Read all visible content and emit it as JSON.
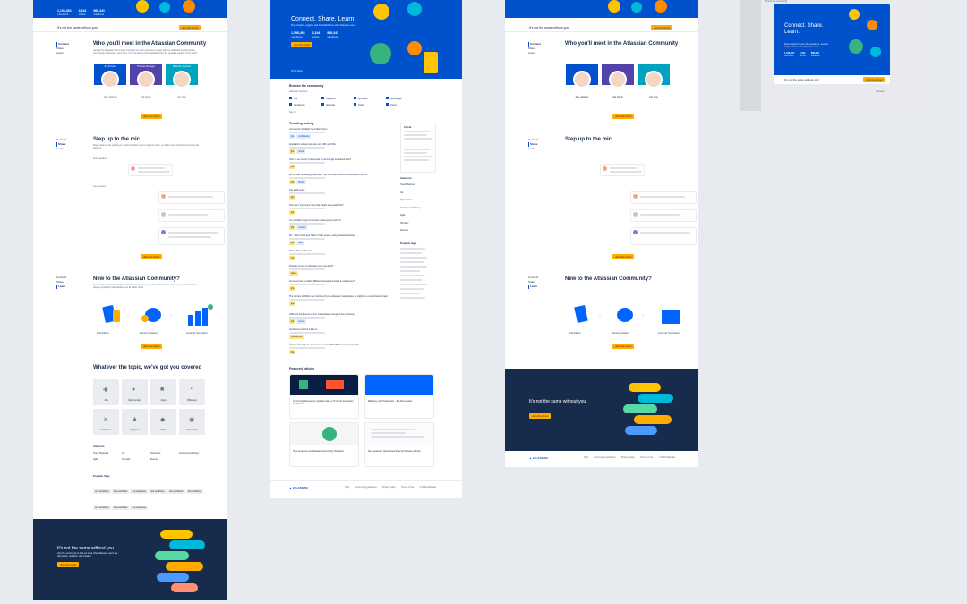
{
  "boards": {
    "community_a": {
      "hero_stats": [
        {
          "value": "1,198,454",
          "label": "members"
        },
        {
          "value": "2,344",
          "label": "online"
        },
        {
          "value": "886,341",
          "label": "solutions"
        }
      ],
      "banner_text": "It's not the same without you!",
      "banner_button": "Join the Crew",
      "meet_title": "Who you'll meet in the Atlassian Community",
      "meet_body": "Joining the Atlassian Community connects you with new users, power admins, Atlassian product teams, Community Champions, and more. You'll be able to find inspiration from the greatest experts in the world.",
      "people": [
        {
          "tag": "Jira Product",
          "name": "Jose Jackson"
        },
        {
          "tag": "Thomas Gutfleger",
          "name": "Jira Admin"
        },
        {
          "tag": "Shannon Quyreck",
          "name": "Jira User"
        }
      ],
      "join_button": "Join the Crew",
      "side_nav": [
        "Connect",
        "Share",
        "Learn"
      ],
      "mic_title": "Step up to the mic",
      "mic_body": "Share what you're working on, what workflows you're trying to solve, or what's new, and the community will weigh in.",
      "ask_label": "Ask Questions",
      "get_label": "Get Answers",
      "new_title": "New to the Atlassian Community?",
      "new_body": "Community can't wait to help you find answers to your questions, find a place where you can learn from a diverse group of professionals from all walks of life.",
      "steps": [
        "Find Articles",
        "Discover Answers",
        "Level Up Your Career"
      ],
      "topics_title": "Whatever the topic, we've got you covered",
      "topics": [
        "Jira",
        "Opportunities",
        "Apps",
        "Bitbucket",
        "Confluence",
        "Opsgenie",
        "Trello",
        "Statuspage"
      ],
      "interests_title": "Interests",
      "interests": [
        "Team Playbook",
        "Git",
        "Teamwork",
        "Continuous Delivery",
        "Agile",
        "Off-topic",
        "Events"
      ],
      "popular_title": "Popular Tags",
      "popular_tags": [
        "Jira workflows",
        "Jira workflows",
        "Jira workflows",
        "Jira workflows",
        "Jira workflows",
        "Jira workflows",
        "Jira workflows",
        "Jira workflows",
        "Jira workflows"
      ],
      "footer_title": "It's not the same without you",
      "footer_body": "Join the community to find out what other Atlassian users are discussing, debating, and creating.",
      "footer_button": "Join the Crew"
    },
    "community_b": {
      "hero_title": "Connect. Share. Learn",
      "hero_body": "Find answers, support, and inspiration from other Atlassian users.",
      "hero_stats": [
        {
          "value": "1,198,454",
          "label": "members"
        },
        {
          "value": "2,344",
          "label": "online"
        },
        {
          "value": "886,341",
          "label": "solutions"
        }
      ],
      "join_button": "Join the Crew",
      "scroll_label": "Scroll down",
      "browse_title": "Browse the community",
      "products_label": "Atlassian products",
      "products": [
        "Jira",
        "Opsgenie",
        "Bitbucket",
        "Statuspage",
        "Confluence",
        "Atlassian",
        "Trello",
        "Cloud"
      ],
      "see_all": "See all",
      "trending_title": "Trending activity",
      "trending": [
        "Community Spotlight: Lynn Bachmann",
        "Application without path key with URL and SSL",
        "How to set custom (Cloud) ask to put through scheduled task?",
        "Errors after updating groupshape, Jira Soft and column on Firefox and Chrome",
        "Jira audit report",
        "How can I implement rules that initiate user-tasks first?",
        "Is it possible to get convention duties going custom?",
        "Fix: I filter Command Total on both screen, using methods provided",
        "Rating filter audit report",
        "Possible to end in individual users via slack?",
        "And also how to publish (Bitbucket/new) test board in confluence?",
        "The content of JIRA is no controlled by the atlassian marketplace, is might be a non-scheduled task",
        "JIRA and Confluence server connecting to foreign hosts in Internet",
        "Confluence for Jira 6.4 to us",
        "Using a rich projects allow assure errors JIRA RSS to support identifier"
      ],
      "featured_title": "Featured articles",
      "featured": [
        "Community Resources: Quickly make a Tf cosmic discussion Confluence",
        "Efficiency and Productivity - Jira Discussions",
        "How to become an Atlassian Community Champion",
        "New Features: Streamlined Flow for Release Admins"
      ],
      "interests_title": "Interests",
      "interests": [
        "Team Playbook",
        "Git",
        "Opensource",
        "Continuous Delivery",
        "Agile",
        "Off-topic",
        "DevOps"
      ],
      "tags_title": "Popular tags",
      "footer_links": [
        "Help",
        "Community guidelines",
        "Privacy policy",
        "Terms of use",
        "© 2019 Atlassian"
      ],
      "logo": "ATLASSIAN",
      "circle_title": "Circle"
    },
    "community_c": {
      "meet_title": "Who you'll meet in the Atlassian Community",
      "people": [
        "Jose Jackson",
        "Jira Admin",
        "Jira User"
      ],
      "join_button": "Join the Crew",
      "mic_title": "Step up to the mic",
      "new_title": "New to the Atlassian Community?",
      "steps": [
        "Find Articles",
        "Discover Answers",
        "Level Up Your Career"
      ],
      "footer_title": "It's not the same without you",
      "footer_button": "Join the Crew",
      "logo": "ATLASSIAN",
      "footer_links": [
        "Help",
        "Community guidelines",
        "Privacy policy",
        "Terms of use",
        "© 2019 Atlassian"
      ],
      "banner_text": "It's not the same without you!"
    },
    "modal": {
      "title": "Connect. Share. Learn.",
      "body": "Find answers in your Jira questions, and get inspired from other Atlassian users.",
      "stats": [
        "1,198,454",
        "2,344",
        "886,341"
      ],
      "stat_labels": [
        "members",
        "online",
        "solutions"
      ],
      "banner_text": "It's not the same without you!",
      "button": "Join the Crew",
      "browse": "Browse the community",
      "interests": "Interests"
    }
  },
  "colors": {
    "blue": "#0052cc",
    "navy": "#172b4d",
    "yellow": "#ffab00",
    "bg": "#e7ebf0"
  }
}
